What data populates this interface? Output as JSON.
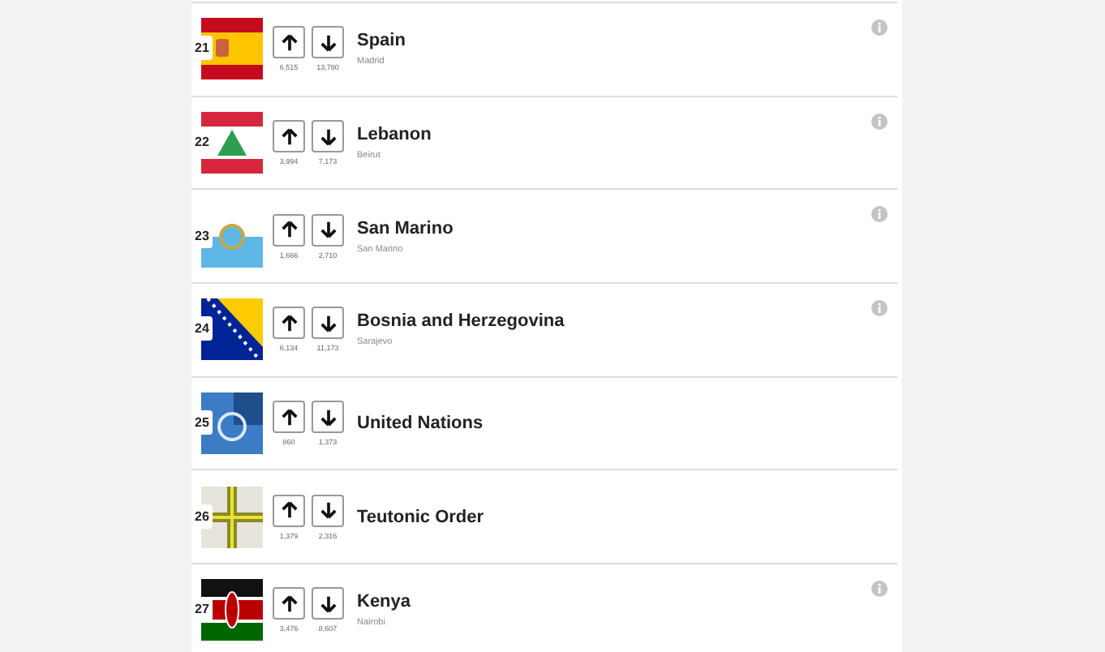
{
  "rows": [
    {
      "rank": "21",
      "kind": "spain",
      "name": "Spain",
      "capital": "Madrid",
      "up": "6,515",
      "down": "13,780",
      "info": true
    },
    {
      "rank": "22",
      "kind": "lebanon",
      "name": "Lebanon",
      "capital": "Beirut",
      "up": "3,994",
      "down": "7,173",
      "info": true
    },
    {
      "rank": "23",
      "kind": "sanmarino",
      "name": "San Marino",
      "capital": "San Marino",
      "up": "1,666",
      "down": "2,710",
      "info": true
    },
    {
      "rank": "24",
      "kind": "bosnia",
      "name": "Bosnia and Herzegovina",
      "capital": "Sarajevo",
      "up": "6,134",
      "down": "11,173",
      "info": true
    },
    {
      "rank": "25",
      "kind": "un",
      "name": "United Nations",
      "up": "860",
      "down": "1,373",
      "info": false
    },
    {
      "rank": "26",
      "kind": "teutonic",
      "name": "Teutonic Order",
      "up": "1,379",
      "down": "2,316",
      "info": false
    },
    {
      "rank": "27",
      "kind": "kenya",
      "name": "Kenya",
      "capital": "Nairobi",
      "up": "3,476",
      "down": "8,607",
      "info": true
    }
  ]
}
